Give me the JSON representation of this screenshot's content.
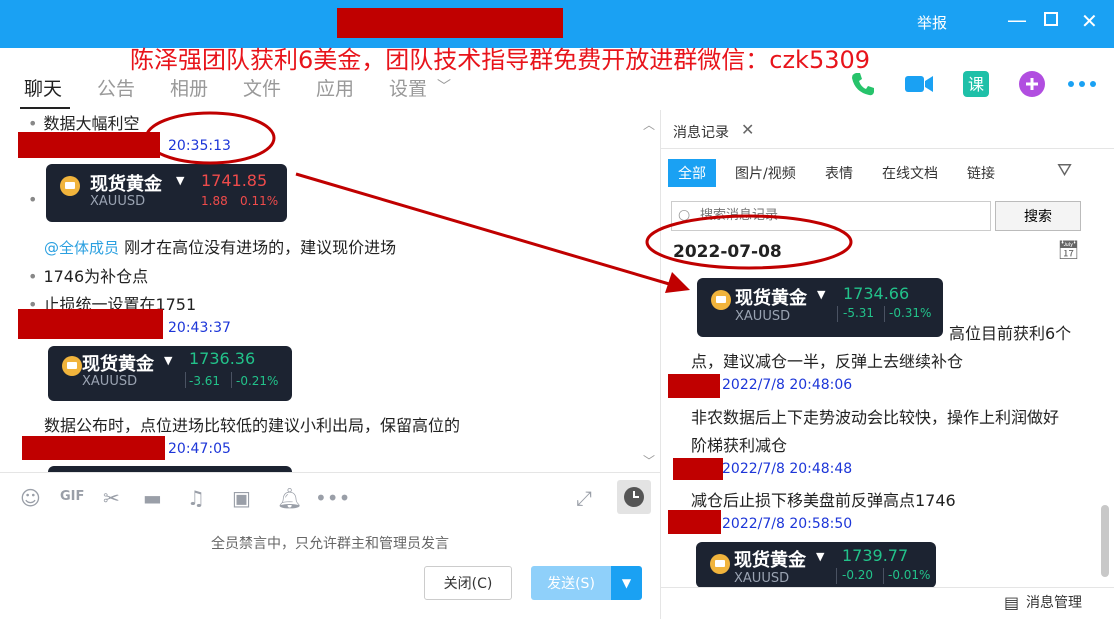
{
  "window": {
    "report_label": "举报",
    "overlay_banner": "陈泽强团队获利6美金，团队技术指导群免费开放进群微信：czk5309"
  },
  "nav": {
    "tabs": [
      "聊天",
      "公告",
      "相册",
      "文件",
      "应用",
      "设置"
    ],
    "settings_arrow": "﹀"
  },
  "chat": {
    "top_text": "数据大幅利空",
    "messages": [
      {
        "time": "20:35:13"
      },
      {
        "time": "20:43:37"
      },
      {
        "time": "20:47:05"
      }
    ],
    "card1": {
      "name": "现货黄金",
      "symbol": "XAUUSD",
      "price": "1741.85",
      "change": "1.88",
      "pct": "0.11%"
    },
    "mention": "@全体成员",
    "line_a": "刚才在高位没有进场的，建议现价进场",
    "line_b": "1746为补仓点",
    "line_c": "止损统一设置在1751",
    "card2": {
      "name": "现货黄金",
      "symbol": "XAUUSD",
      "price": "1736.36",
      "change": "-3.61",
      "pct": "-0.21%"
    },
    "line_d": "数据公布时，点位进场比较低的建议小利出局，保留高位的"
  },
  "input": {
    "mute_notice": "全员禁言中，只允许群主和管理员发言",
    "close_btn": "关闭(C)",
    "send_btn": "发送(S)"
  },
  "history": {
    "panel_title": "消息记录",
    "filters": [
      "全部",
      "图片/视频",
      "表情",
      "在线文档",
      "链接"
    ],
    "search_placeholder": "搜索消息记录",
    "search_btn": "搜索",
    "date": "2022-07-08",
    "card1": {
      "name": "现货黄金",
      "symbol": "XAUUSD",
      "price": "1734.66",
      "change": "-5.31",
      "pct": "-0.31%"
    },
    "msg1_a": "高位目前获利6个",
    "msg1_b": "点，建议减仓一半，反弹上去继续补仓",
    "ts1": "2022/7/8 20:48:06",
    "msg2_a": "非农数据后上下走势波动会比较快，操作上利润做好",
    "msg2_b": "阶梯获利减仓",
    "ts2": "2022/7/8 20:48:48",
    "msg3": "减仓后止损下移美盘前反弹高点1746",
    "ts3": "2022/7/8 20:58:50",
    "card2": {
      "name": "现货黄金",
      "symbol": "XAUUSD",
      "price": "1739.77",
      "change": "-0.20",
      "pct": "-0.01%"
    },
    "manage_label": "消息管理"
  },
  "colors": {
    "accent": "#1aa1f3",
    "up": "#ef4b4b",
    "down": "#22c28a",
    "timestamp": "#1d36d8",
    "annotation": "#c00000"
  }
}
